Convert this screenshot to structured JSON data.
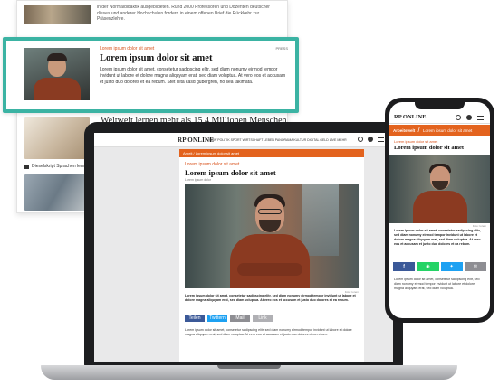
{
  "background_page": {
    "intro_text": "in der Normaldidaktik ausgebildeten. Rund 2000 Professoren und Dozenten deutscher dieses und anderer Hochschulen fordern in einem offenen Brief die Rückkehr zur Präsenzlehre.",
    "teaser": {
      "kicker": "Lorem ipsum dolor sit amet",
      "badge": "PRESS",
      "title": "Lorem ipsum dolor sit amet",
      "text": "Lorem ipsum dolor sit amet, consetetur sadipscing elitr, sed diam nonumy eirmod tempor invidunt ut labore et dolore magna aliquyam erat, sed diam voluptua. At vero eos et accusam et justo duo dolores et ea rebum. Stet clita kasd gubergren, no sea takimata."
    },
    "headline": "Weltweit lernen mehr als 15,4 Millionen Menschen",
    "caption": "Dieselskript Sprachen lernen"
  },
  "laptop": {
    "logo": "RP ONLINE",
    "menu": "NRW  POLITIK  SPORT  WIRTSCHAFT  LEBEN  PANORAMA  KULTUR  DIGITAL  GELD  LIVE  MEHR",
    "crumb": "Arbeit / Lorem ipsum dolor sit amet",
    "kicker": "Lorem ipsum dolor sit amet",
    "title": "Lorem ipsum dolor sit amet",
    "byline": "Lorem ipsum dolor",
    "image_credit": "Foto: lorem",
    "lead": "Lorem ipsum dolor sit amet, consetetur sadipscing elitr, sed diam nonumy eirmod tempor invidunt ut labore et dolore magna aliquyam erat, sed diam voluptua. At vero eos et accusam et justo duo dolores et ea rebum.",
    "share": [
      "Teilen",
      "Twittern",
      "Mail",
      "Link"
    ],
    "body": "Lorem ipsum dolor sit amet, consetetur sadipscing elitr, sed diam nonumy eirmod tempor invidunt ut labore et dolore magna aliquyam erat, sed diam voluptua. At vero eos et accusam et justo duo dolores et ea rebum."
  },
  "phone": {
    "logo": "RP ONLINE",
    "crumb_section": "Arbeitswelt",
    "crumb_text": "Lorem ipsum dolor sit amet",
    "kicker": "Lorem ipsum dolor sit amet",
    "title": "Lorem ipsum dolor sit amet",
    "image_credit": "Foto: lorem",
    "lead": "Lorem ipsum dolor sit amet, consetetur sadipscing elitr, sed diam nonumy eirmod tempor invidunt ut labore et dolore magna aliquyam erat, sed diam voluptua. At vero eos et accusam et justo duo dolores et ea rebum.",
    "body": "Lorem ipsum dolor sit amet, consetetur sadipscing elitr, sed diam nonumy eirmod tempor invidunt ut labore et dolore magna aliquyam erat, sed diam voluptua."
  },
  "colors": {
    "accent_teal": "#3bb3a3",
    "brand_orange": "#e3631e",
    "facebook": "#3b5998",
    "twitter": "#1da1f2",
    "whatsapp": "#25d366",
    "mail": "#8e8e93"
  }
}
